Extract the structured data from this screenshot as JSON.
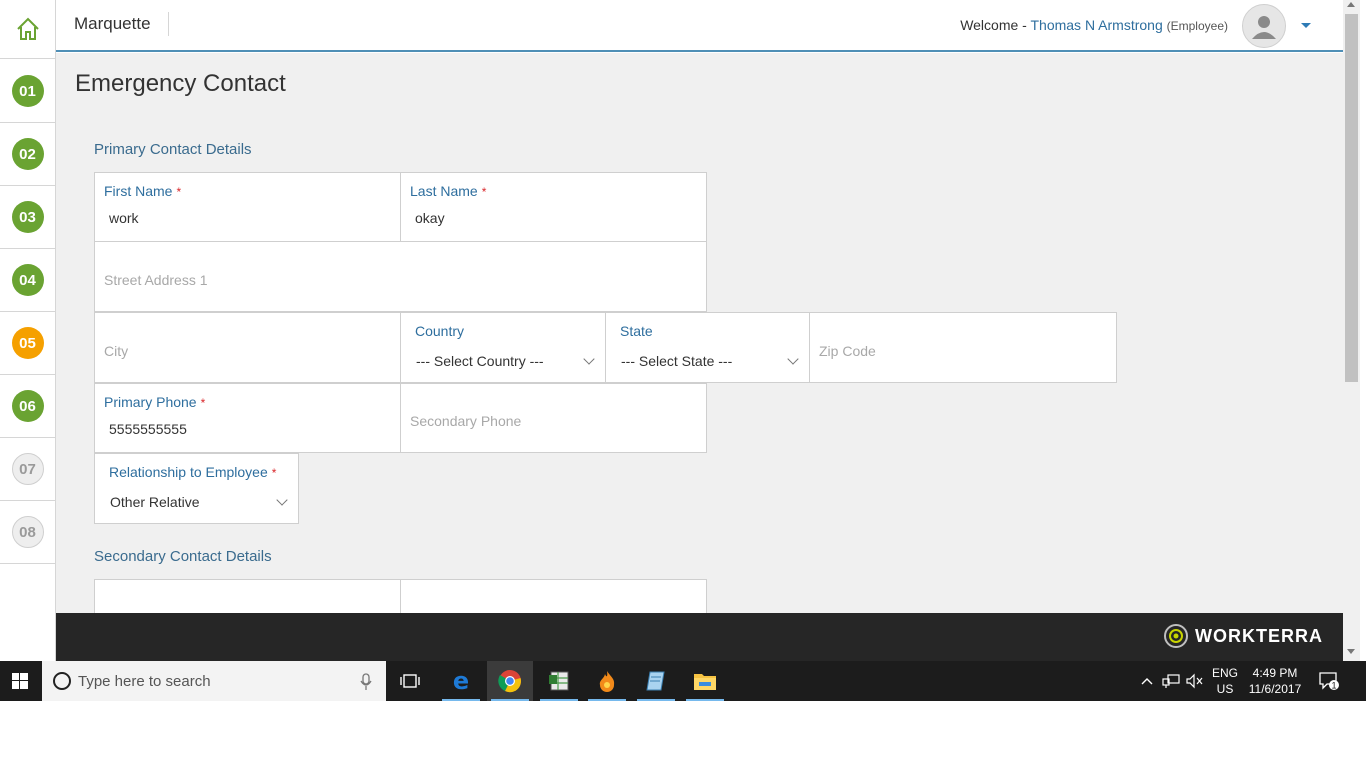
{
  "header": {
    "brand": "Marquette",
    "welcome_prefix": "Welcome -",
    "user_name": "Thomas N Armstrong",
    "user_role": "(Employee)"
  },
  "steps": [
    {
      "label": "01",
      "state": "done"
    },
    {
      "label": "02",
      "state": "done"
    },
    {
      "label": "03",
      "state": "done"
    },
    {
      "label": "04",
      "state": "done"
    },
    {
      "label": "05",
      "state": "active"
    },
    {
      "label": "06",
      "state": "done"
    },
    {
      "label": "07",
      "state": "todo"
    },
    {
      "label": "08",
      "state": "todo"
    }
  ],
  "page": {
    "title": "Emergency Contact",
    "primary_section": "Primary Contact Details",
    "secondary_section": "Secondary Contact Details"
  },
  "form": {
    "first_name": {
      "label": "First Name",
      "required": "*",
      "value": "work"
    },
    "last_name": {
      "label": "Last Name",
      "required": "*",
      "value": "okay"
    },
    "street1": {
      "placeholder": "Street Address 1"
    },
    "city": {
      "placeholder": "City"
    },
    "country": {
      "label": "Country",
      "value": "--- Select Country ---"
    },
    "state": {
      "label": "State",
      "value": "--- Select State ---"
    },
    "zip": {
      "placeholder": "Zip Code"
    },
    "primary_phone": {
      "label": "Primary Phone",
      "required": "*",
      "value": "5555555555"
    },
    "secondary_phone": {
      "placeholder": "Secondary Phone"
    },
    "relationship": {
      "label": "Relationship to Employee",
      "required": "*",
      "value": "Other Relative"
    }
  },
  "footer": {
    "logo_text": "WORKTERRA"
  },
  "taskbar": {
    "search_placeholder": "Type here to search",
    "lang_line1": "ENG",
    "lang_line2": "US",
    "time": "4:49 PM",
    "date": "11/6/2017",
    "notification_count": "1"
  },
  "colors": {
    "step_done": "#6aa332",
    "step_active": "#f5a000",
    "header_rule": "#4f8fb6",
    "label_blue": "#2e6e9e",
    "footer_bg": "#262626"
  }
}
